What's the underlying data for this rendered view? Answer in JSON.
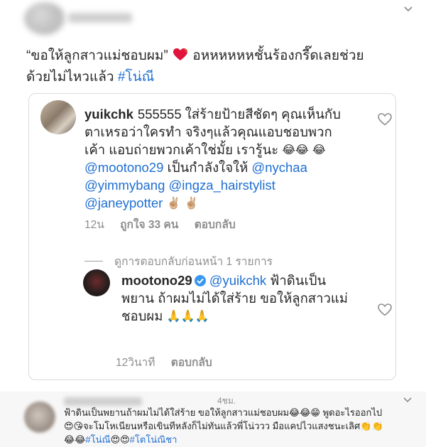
{
  "top_post": {
    "caption_quote": "“ขอให้ลูกสาวแม่ชอบผม”",
    "caption_rest_line1": " อหหหหหหชั้นร้องกรี๊ดเลยช่วย",
    "caption_line2": "ด้วยไม่ไหวแล้ว ",
    "hashtag": "#โน่ณี"
  },
  "comment_1": {
    "username": "yuikchk",
    "text_a": "555555 ใส่ร้ายป้ายสีชัดๆ คุณเห็นกับตาเหรอว่าใครทำ จริงๆแล้วคุณแอบชอบพวกเค้า แอบถ่ายพวกเค้าใช่มั้ย เรารู้นะ ",
    "emoji_laugh": "😂",
    "mention_1": "@mootono29",
    "text_b": " เป็นกำลังใจให้ ",
    "mention_2": "@nychaa",
    "mention_3": "@yimmybang",
    "mention_4": "@ingza_hairstylist",
    "mention_5": "@janeypotter",
    "emoji_peace": "✌🏼",
    "time": "12น",
    "likes": "ถูกใจ 33 คน",
    "reply": "ตอบกลับ"
  },
  "view_replies": "ดูการตอบกลับก่อนหน้า 1 รายการ",
  "comment_2": {
    "username": "mootono29",
    "mention": "@yuikchk",
    "text": " ฟ้าดินเป็นพยาน ถ้าผมไม่ได้ใส่ร้าย ขอให้ลูกสาวแม่ชอบผม ",
    "emoji_pray": "🙏🙏🙏",
    "time": "12วินาที",
    "reply": "ตอบกลับ"
  },
  "bottom_comment": {
    "time": "4ชม.",
    "text_1": "ฟ้าดินเป็นพยานถ้าผมไม่ได้ใส่ร้าย ขอให้ลูกสาวแม่ชอบผม😂😂😁 พูดอะไรออกไป",
    "text_2": "😍😘จะโมโหเนียนหรือเขินทีหลังก็ไม่ทันแล้วพี่โน่ววว มือแคปไวแสงชนะเลิศ👏👏",
    "text_3_emoji": "😂😂",
    "hashtag_1": "#โน่ณี",
    "text_3_mid": "😍😍",
    "hashtag_2": "#โตโน่ณิชา"
  },
  "colors": {
    "link": "#1f6fd1",
    "muted": "#8e8e8e",
    "text": "#262626"
  }
}
